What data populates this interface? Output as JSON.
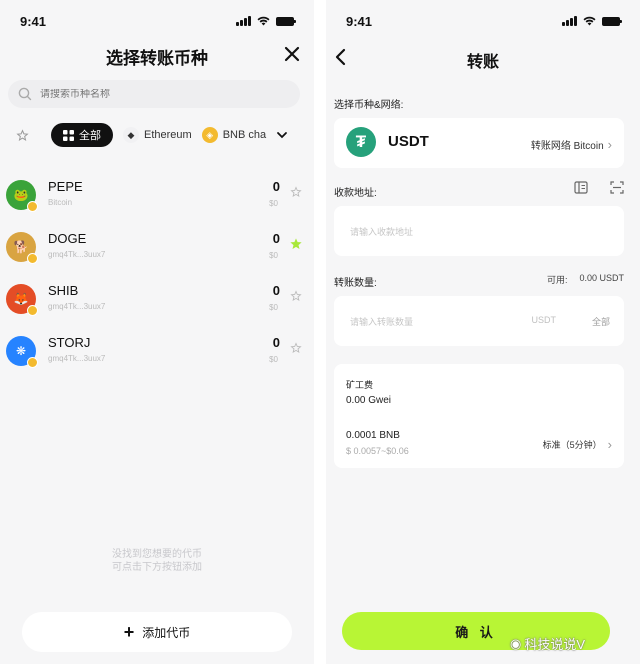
{
  "left": {
    "status_time": "9:41",
    "title": "选择转账币种",
    "search_placeholder": "请搜索币种名称",
    "filters": {
      "all_label": "全部",
      "ethereum_label": "Ethereum",
      "bnb_label": "BNB cha"
    },
    "tokens": [
      {
        "name": "PEPE",
        "sub": "Bitcoin",
        "balance": "0",
        "usd": "$0",
        "color": "#3aa33a",
        "starred": false
      },
      {
        "name": "DOGE",
        "sub": "gmq4Tk...3uux7",
        "balance": "0",
        "usd": "$0",
        "color": "#d9a441",
        "starred": true
      },
      {
        "name": "SHIB",
        "sub": "gmq4Tk...3uux7",
        "balance": "0",
        "usd": "$0",
        "color": "#e44d26",
        "starred": false
      },
      {
        "name": "STORJ",
        "sub": "gmq4Tk...3uux7",
        "balance": "0",
        "usd": "$0",
        "color": "#2683ff",
        "starred": false
      }
    ],
    "empty_hint_1": "没找到您想要的代币",
    "empty_hint_2": "可点击下方按钮添加",
    "add_label": "添加代币"
  },
  "right": {
    "status_time": "9:41",
    "title": "转账",
    "coin_network_label": "选择币种&网络:",
    "coin_name": "USDT",
    "network_label": "转账网络 Bitcoin",
    "address_label": "收款地址:",
    "address_placeholder": "请输入收款地址",
    "amount_label": "转账数量:",
    "available_label": "可用:",
    "available_value": "0.00 USDT",
    "amount_placeholder": "请输入转账数量",
    "amount_unit": "USDT",
    "amount_all": "全部",
    "fee_label": "矿工费",
    "fee_gwei": "0.00 Gwei",
    "fee_bnb": "0.0001 BNB",
    "fee_usd": "$ 0.0057~$0.06",
    "fee_speed": "标准（5分钟）",
    "confirm_label": "确 认",
    "watermark": "科技说说V"
  },
  "colors": {
    "accent": "#b8f535",
    "tether": "#26a17b",
    "bnb": "#f3ba2f",
    "star_active": "#a8e83a"
  }
}
